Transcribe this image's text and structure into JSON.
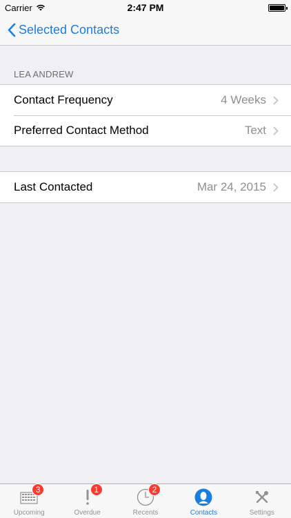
{
  "status": {
    "carrier": "Carrier",
    "time": "2:47 PM"
  },
  "nav": {
    "back_label": "Selected Contacts"
  },
  "section": {
    "header": "LEA ANDREW"
  },
  "rows": [
    {
      "label": "Contact Frequency",
      "value": "4 Weeks"
    },
    {
      "label": "Preferred Contact Method",
      "value": "Text"
    }
  ],
  "rows2": [
    {
      "label": "Last Contacted",
      "value": "Mar 24, 2015"
    }
  ],
  "tabs": [
    {
      "label": "Upcoming",
      "badge": "3",
      "icon": "calendar-grid-icon"
    },
    {
      "label": "Overdue",
      "badge": "1",
      "icon": "exclamation-icon"
    },
    {
      "label": "Recents",
      "badge": "2",
      "icon": "clock-icon"
    },
    {
      "label": "Contacts",
      "badge": "",
      "icon": "contact-silhouette-icon"
    },
    {
      "label": "Settings",
      "badge": "",
      "icon": "tools-icon"
    }
  ],
  "colors": {
    "accent": "#1a7ee0",
    "badge": "#ff3b30",
    "background": "#efeff4"
  }
}
